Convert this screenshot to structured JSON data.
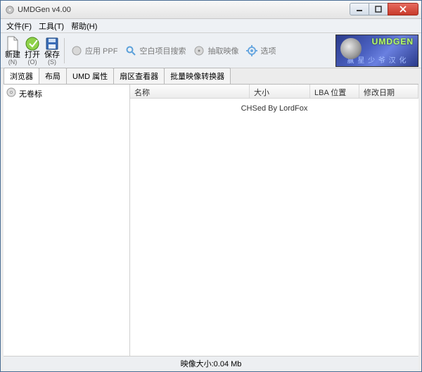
{
  "titlebar": {
    "title": "UMDGen v4.00"
  },
  "menubar": {
    "file": "文件(F)",
    "tools": "工具(T)",
    "help": "帮助(H)"
  },
  "toolbar": {
    "new": {
      "label": "新建",
      "shortcut": "(N)"
    },
    "open": {
      "label": "打开",
      "shortcut": "(O)"
    },
    "save": {
      "label": "保存",
      "shortcut": "(S)"
    },
    "apply_ppf": "应用 PPF",
    "blank_search": "空白项目搜索",
    "extract_image": "抽取映像",
    "options": "选项"
  },
  "brand": {
    "top": "UMDGEN",
    "bottom": "赢 星 少 爷 汉 化"
  },
  "tabs": {
    "browser": "浏览器",
    "layout": "布局",
    "umd_props": "UMD 属性",
    "sector_viewer": "扇区查看器",
    "batch_converter": "批量映像转换器"
  },
  "tree": {
    "root": "无卷标"
  },
  "columns": {
    "name": "名称",
    "size": "大小",
    "lba": "LBA 位置",
    "mdate": "修改日期"
  },
  "list": {
    "placeholder": "CHSed By LordFox"
  },
  "status": {
    "size_label": "映像大小:0.04 Mb"
  }
}
